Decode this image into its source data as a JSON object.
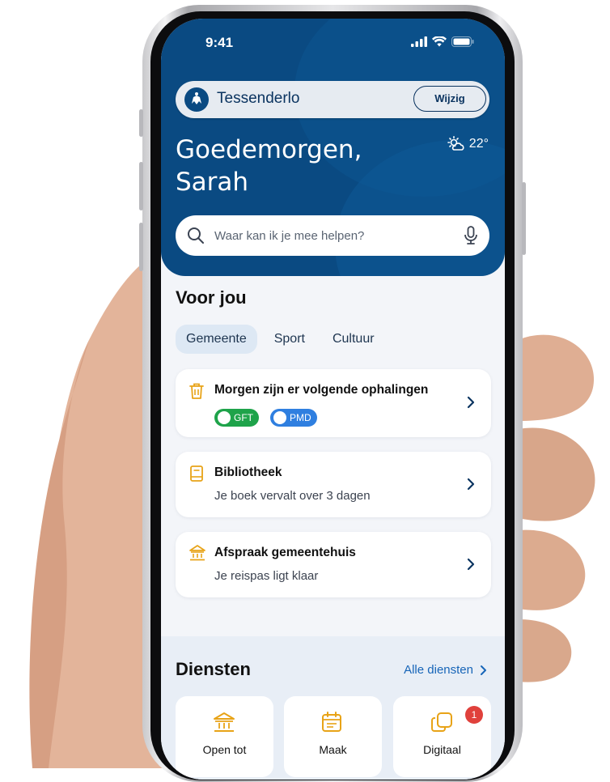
{
  "status": {
    "time": "9:41"
  },
  "header": {
    "city": "Tessenderlo",
    "change_label": "Wijzig",
    "weather_temp": "22°",
    "weather_icon": "sun-cloud-icon",
    "greeting_line1": "Goedemorgen,",
    "greeting_line2": "Sarah"
  },
  "search": {
    "placeholder": "Waar kan ik je mee helpen?"
  },
  "for_you": {
    "title": "Voor jou",
    "tabs": [
      {
        "label": "Gemeente",
        "active": true
      },
      {
        "label": "Sport",
        "active": false
      },
      {
        "label": "Cultuur",
        "active": false
      }
    ]
  },
  "cards": [
    {
      "icon": "trash-icon",
      "title": "Morgen zijn er volgende ophalingen",
      "tags": [
        {
          "label": "GFT",
          "color": "#1ea34a"
        },
        {
          "label": "PMD",
          "color": "#2f7fe0"
        }
      ]
    },
    {
      "icon": "book-icon",
      "title": "Bibliotheek",
      "subtitle": "Je boek vervalt over 3 dagen"
    },
    {
      "icon": "townhall-icon",
      "title": "Afspraak gemeentehuis",
      "subtitle": "Je reispas ligt klaar"
    }
  ],
  "services": {
    "title": "Diensten",
    "all_link": "Alle diensten",
    "items": [
      {
        "label": "Open tot",
        "icon": "townhall-icon"
      },
      {
        "label": "Maak",
        "icon": "calendar-icon"
      },
      {
        "label": "Digitaal",
        "icon": "copy-icon",
        "badge": "1"
      }
    ]
  },
  "colors": {
    "brand": "#0a4a82",
    "accent_icon": "#e8a317",
    "link": "#1765b8"
  }
}
